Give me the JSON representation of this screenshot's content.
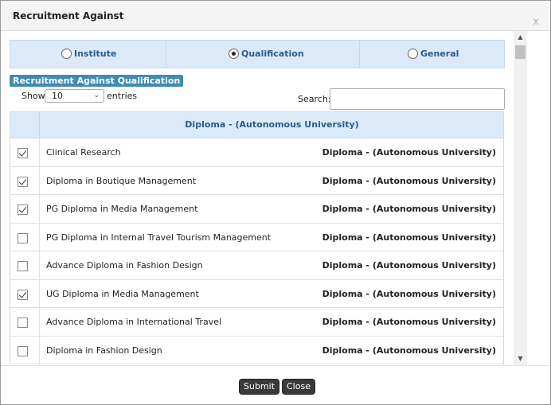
{
  "dialog": {
    "title": "Recruitment Against",
    "close_glyph": "x"
  },
  "radio_options": [
    {
      "label": "Institute",
      "selected": false
    },
    {
      "label": "Qualification",
      "selected": true
    },
    {
      "label": "General",
      "selected": false
    }
  ],
  "section_tag": "Recruitment Against Qualification",
  "length_control": {
    "show_label": "Show",
    "selected_value": "10",
    "entries_label": "entries"
  },
  "search": {
    "label": "Search:",
    "value": ""
  },
  "table": {
    "header": "Diploma - (Autonomous University)",
    "rows": [
      {
        "name": "Clinical Research",
        "type": "Diploma - (Autonomous University)",
        "checked": true
      },
      {
        "name": "Diploma in Boutique Management",
        "type": "Diploma - (Autonomous University)",
        "checked": true
      },
      {
        "name": "PG Diploma in Media Management",
        "type": "Diploma - (Autonomous University)",
        "checked": true
      },
      {
        "name": "PG Diploma in Internal Travel Tourism Management",
        "type": "Diploma - (Autonomous University)",
        "checked": false
      },
      {
        "name": "Advance Diploma in Fashion Design",
        "type": "Diploma - (Autonomous University)",
        "checked": false
      },
      {
        "name": "UG Diploma in Media Management",
        "type": "Diploma - (Autonomous University)",
        "checked": true
      },
      {
        "name": "Advance Diploma in International Travel",
        "type": "Diploma - (Autonomous University)",
        "checked": false
      },
      {
        "name": "Diploma in Fashion Design",
        "type": "Diploma - (Autonomous University)",
        "checked": false
      }
    ]
  },
  "buttons": {
    "submit": "Submit",
    "close": "Close"
  },
  "colors": {
    "header_blue": "#dce9f9",
    "label_blue": "#2a5a8c",
    "tag_blue": "#3f8bb5",
    "button_dark": "#3a3a3a"
  }
}
